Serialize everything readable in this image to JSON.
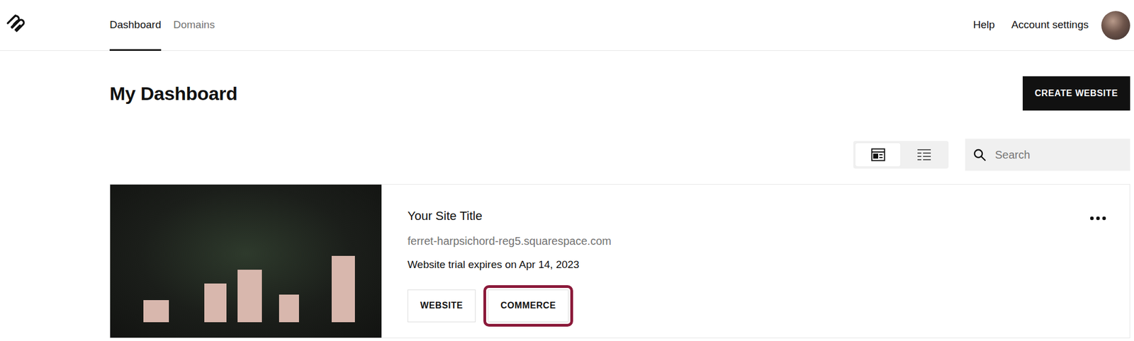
{
  "nav": {
    "tabs": [
      {
        "label": "Dashboard",
        "selected": true
      },
      {
        "label": "Domains",
        "selected": false
      }
    ],
    "links": [
      "Help",
      "Account settings"
    ]
  },
  "heading": "My Dashboard",
  "create_button": "CREATE WEBSITE",
  "view_toggle": [
    {
      "view": "grid",
      "selected": true
    },
    {
      "view": "list",
      "selected": false
    }
  ],
  "search": {
    "placeholder": "Search"
  },
  "sites": [
    {
      "title": "Your Site Title",
      "url": "ferret-harpsichord-reg5.squarespace.com",
      "trial": "Website trial expires on Apr 14, 2023",
      "buttons": [
        {
          "label": "WEBSITE",
          "highlighted": false
        },
        {
          "label": "COMMERCE",
          "highlighted": true
        }
      ]
    }
  ]
}
